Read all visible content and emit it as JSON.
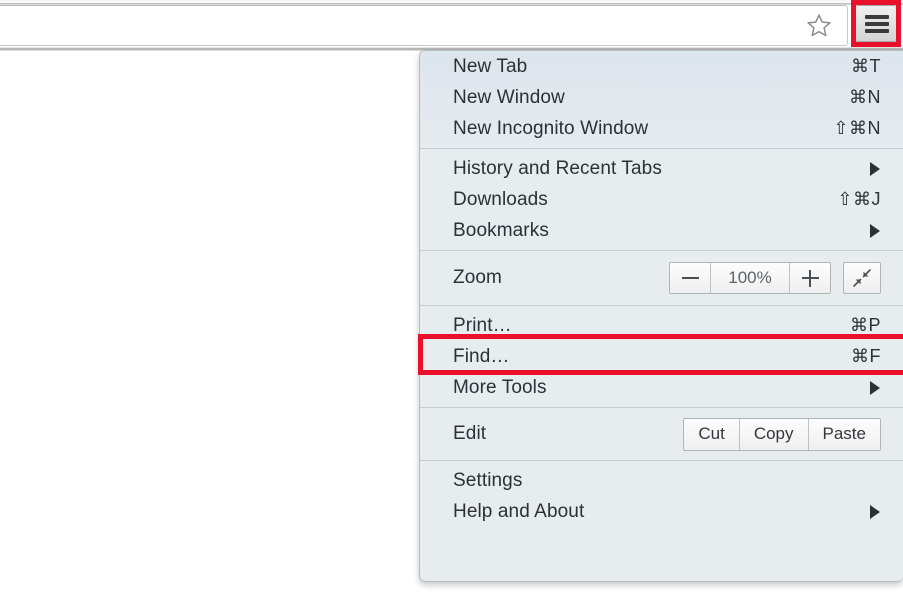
{
  "browser": {
    "omnibox": {
      "value": "",
      "placeholder": ""
    },
    "star_icon": "star-icon",
    "menu_button_icon": "hamburger-menu-icon"
  },
  "menu": {
    "groups": [
      {
        "id": "new",
        "items": [
          {
            "label": "New Tab",
            "shortcut": "⌘T",
            "arrow": false
          },
          {
            "label": "New Window",
            "shortcut": "⌘N",
            "arrow": false
          },
          {
            "label": "New Incognito Window",
            "shortcut": "⇧⌘N",
            "arrow": false
          }
        ]
      },
      {
        "id": "browsing",
        "items": [
          {
            "label": "History and Recent Tabs",
            "shortcut": "",
            "arrow": true
          },
          {
            "label": "Downloads",
            "shortcut": "⇧⌘J",
            "arrow": false
          },
          {
            "label": "Bookmarks",
            "shortcut": "",
            "arrow": true
          }
        ]
      },
      {
        "id": "zoom",
        "items": [
          {
            "label": "Zoom",
            "shortcut": "",
            "arrow": false
          }
        ]
      },
      {
        "id": "page",
        "items": [
          {
            "label": "Print…",
            "shortcut": "⌘P",
            "arrow": false
          },
          {
            "label": "Find…",
            "shortcut": "⌘F",
            "arrow": false
          },
          {
            "label": "More Tools",
            "shortcut": "",
            "arrow": true
          }
        ]
      },
      {
        "id": "edit",
        "items": [
          {
            "label": "Edit",
            "shortcut": "",
            "arrow": false
          }
        ]
      },
      {
        "id": "settings",
        "items": [
          {
            "label": "Settings",
            "shortcut": "",
            "arrow": false
          },
          {
            "label": "Help and About",
            "shortcut": "",
            "arrow": true
          }
        ]
      }
    ],
    "zoom": {
      "label": "Zoom",
      "decrease_icon": "minus-icon",
      "value": "100%",
      "increase_icon": "plus-icon",
      "fullscreen_icon": "fullscreen-icon"
    },
    "edit": {
      "label": "Edit",
      "cut": "Cut",
      "copy": "Copy",
      "paste": "Paste"
    }
  },
  "highlights": {
    "accent_color": "#e8102a",
    "targets": [
      "hamburger-menu-icon",
      "Print…"
    ]
  }
}
